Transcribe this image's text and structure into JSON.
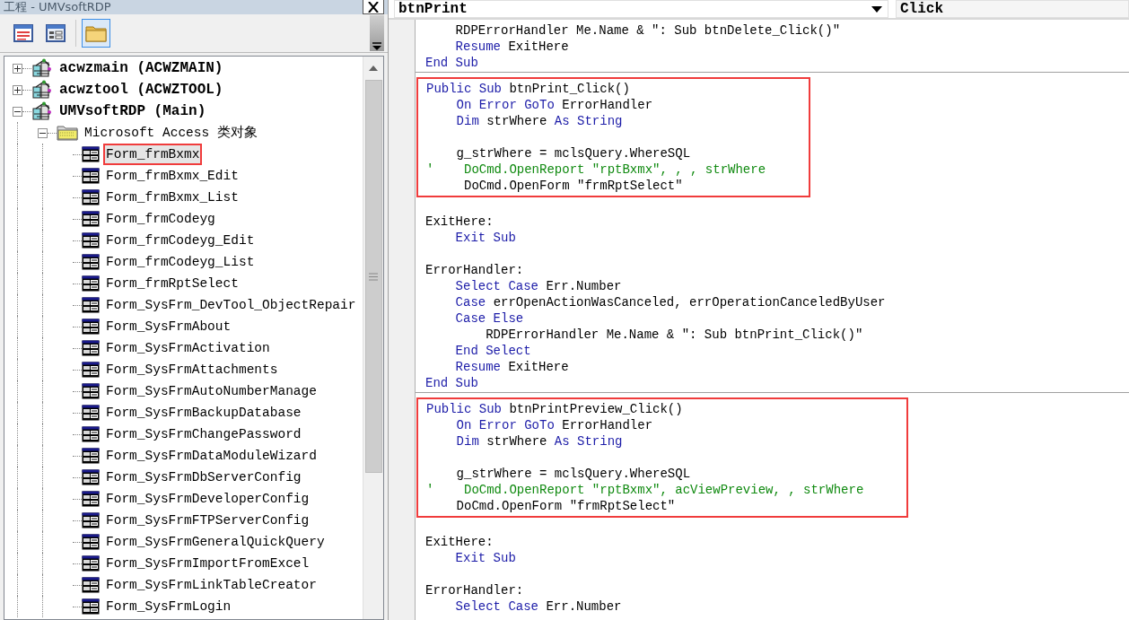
{
  "project_window": {
    "title": "工程 - UMVsoftRDP",
    "toolbar": [
      {
        "kind": "view-code",
        "selected": false
      },
      {
        "kind": "view-object",
        "selected": false
      },
      {
        "kind": "toggle-folders",
        "selected": true
      }
    ],
    "tree": [
      {
        "kind": "project",
        "label": "acwzmain (ACWZMAIN)",
        "expanded": false,
        "selected": false
      },
      {
        "kind": "project",
        "label": "acwztool (ACWZTOOL)",
        "expanded": false,
        "selected": false
      },
      {
        "kind": "project",
        "label": "UMVsoftRDP (Main)",
        "expanded": true,
        "selected": false,
        "children": [
          {
            "kind": "folder",
            "label": "Microsoft Access 类对象",
            "expanded": true,
            "selected": false,
            "children": [
              {
                "kind": "form",
                "label": "Form_frmBxmx",
                "selected": true,
                "highlighted": true
              },
              {
                "kind": "form",
                "label": "Form_frmBxmx_Edit",
                "selected": false,
                "highlighted": false
              },
              {
                "kind": "form",
                "label": "Form_frmBxmx_List",
                "selected": false,
                "highlighted": false
              },
              {
                "kind": "form",
                "label": "Form_frmCodeyg",
                "selected": false,
                "highlighted": false
              },
              {
                "kind": "form",
                "label": "Form_frmCodeyg_Edit",
                "selected": false,
                "highlighted": false
              },
              {
                "kind": "form",
                "label": "Form_frmCodeyg_List",
                "selected": false,
                "highlighted": false
              },
              {
                "kind": "form",
                "label": "Form_frmRptSelect",
                "selected": false,
                "highlighted": false
              },
              {
                "kind": "form",
                "label": "Form_SysFrm_DevTool_ObjectRepair",
                "selected": false,
                "highlighted": false
              },
              {
                "kind": "form",
                "label": "Form_SysFrmAbout",
                "selected": false,
                "highlighted": false
              },
              {
                "kind": "form",
                "label": "Form_SysFrmActivation",
                "selected": false,
                "highlighted": false
              },
              {
                "kind": "form",
                "label": "Form_SysFrmAttachments",
                "selected": false,
                "highlighted": false
              },
              {
                "kind": "form",
                "label": "Form_SysFrmAutoNumberManage",
                "selected": false,
                "highlighted": false
              },
              {
                "kind": "form",
                "label": "Form_SysFrmBackupDatabase",
                "selected": false,
                "highlighted": false
              },
              {
                "kind": "form",
                "label": "Form_SysFrmChangePassword",
                "selected": false,
                "highlighted": false
              },
              {
                "kind": "form",
                "label": "Form_SysFrmDataModuleWizard",
                "selected": false,
                "highlighted": false
              },
              {
                "kind": "form",
                "label": "Form_SysFrmDbServerConfig",
                "selected": false,
                "highlighted": false
              },
              {
                "kind": "form",
                "label": "Form_SysFrmDeveloperConfig",
                "selected": false,
                "highlighted": false
              },
              {
                "kind": "form",
                "label": "Form_SysFrmFTPServerConfig",
                "selected": false,
                "highlighted": false
              },
              {
                "kind": "form",
                "label": "Form_SysFrmGeneralQuickQuery",
                "selected": false,
                "highlighted": false
              },
              {
                "kind": "form",
                "label": "Form_SysFrmImportFromExcel",
                "selected": false,
                "highlighted": false
              },
              {
                "kind": "form",
                "label": "Form_SysFrmLinkTableCreator",
                "selected": false,
                "highlighted": false
              },
              {
                "kind": "form",
                "label": "Form_SysFrmLogin",
                "selected": false,
                "highlighted": false
              }
            ]
          }
        ]
      }
    ]
  },
  "code_window": {
    "object_list": "btnPrint",
    "procedure_list": "Click",
    "procedures": [
      {
        "groups": [
          {
            "highlighted": false,
            "lines": [
              {
                "kind": "code",
                "segments": [
                  {
                    "kind": "plain",
                    "text": "    RDPErrorHandler Me.Name & \": Sub btnDelete_Click()\""
                  }
                ]
              },
              {
                "kind": "code",
                "segments": [
                  {
                    "kind": "keyword",
                    "text": "    Resume "
                  },
                  {
                    "kind": "plain",
                    "text": "ExitHere"
                  }
                ]
              },
              {
                "kind": "code",
                "segments": [
                  {
                    "kind": "keyword",
                    "text": "End Sub"
                  }
                ]
              }
            ]
          }
        ]
      },
      {
        "groups": [
          {
            "highlighted": true,
            "lines": [
              {
                "kind": "code",
                "segments": [
                  {
                    "kind": "keyword",
                    "text": "Public Sub "
                  },
                  {
                    "kind": "plain",
                    "text": "btnPrint_Click()"
                  }
                ]
              },
              {
                "kind": "code",
                "segments": [
                  {
                    "kind": "keyword",
                    "text": "    On Error GoTo "
                  },
                  {
                    "kind": "plain",
                    "text": "ErrorHandler"
                  }
                ]
              },
              {
                "kind": "code",
                "segments": [
                  {
                    "kind": "keyword",
                    "text": "    Dim "
                  },
                  {
                    "kind": "plain",
                    "text": "strWhere "
                  },
                  {
                    "kind": "keyword",
                    "text": "As String"
                  }
                ]
              },
              {
                "kind": "blank"
              },
              {
                "kind": "code",
                "segments": [
                  {
                    "kind": "plain",
                    "text": "    g_strWhere = mclsQuery.WhereSQL"
                  }
                ]
              },
              {
                "kind": "code",
                "segments": [
                  {
                    "kind": "comment",
                    "text": "'    DoCmd.OpenReport \"rptBxmx\", , , strWhere"
                  }
                ]
              },
              {
                "kind": "code",
                "segments": [
                  {
                    "kind": "plain",
                    "text": "     DoCmd.OpenForm \"frmRptSelect\""
                  }
                ]
              }
            ]
          },
          {
            "highlighted": false,
            "lines": [
              {
                "kind": "blank"
              },
              {
                "kind": "code",
                "segments": [
                  {
                    "kind": "plain",
                    "text": "ExitHere:"
                  }
                ]
              },
              {
                "kind": "code",
                "segments": [
                  {
                    "kind": "keyword",
                    "text": "    Exit Sub"
                  }
                ]
              },
              {
                "kind": "blank"
              },
              {
                "kind": "code",
                "segments": [
                  {
                    "kind": "plain",
                    "text": "ErrorHandler:"
                  }
                ]
              },
              {
                "kind": "code",
                "segments": [
                  {
                    "kind": "keyword",
                    "text": "    Select Case "
                  },
                  {
                    "kind": "plain",
                    "text": "Err.Number"
                  }
                ]
              },
              {
                "kind": "code",
                "segments": [
                  {
                    "kind": "keyword",
                    "text": "    Case "
                  },
                  {
                    "kind": "plain",
                    "text": "errOpenActionWasCanceled, errOperationCanceledByUser"
                  }
                ]
              },
              {
                "kind": "code",
                "segments": [
                  {
                    "kind": "keyword",
                    "text": "    Case Else"
                  }
                ]
              },
              {
                "kind": "code",
                "segments": [
                  {
                    "kind": "plain",
                    "text": "        RDPErrorHandler Me.Name & \": Sub btnPrint_Click()\""
                  }
                ]
              },
              {
                "kind": "code",
                "segments": [
                  {
                    "kind": "keyword",
                    "text": "    End Select"
                  }
                ]
              },
              {
                "kind": "code",
                "segments": [
                  {
                    "kind": "keyword",
                    "text": "    Resume "
                  },
                  {
                    "kind": "plain",
                    "text": "ExitHere"
                  }
                ]
              },
              {
                "kind": "code",
                "segments": [
                  {
                    "kind": "keyword",
                    "text": "End Sub"
                  }
                ]
              }
            ]
          }
        ]
      },
      {
        "groups": [
          {
            "highlighted": true,
            "lines": [
              {
                "kind": "code",
                "segments": [
                  {
                    "kind": "keyword",
                    "text": "Public Sub "
                  },
                  {
                    "kind": "plain",
                    "text": "btnPrintPreview_Click()"
                  }
                ]
              },
              {
                "kind": "code",
                "segments": [
                  {
                    "kind": "keyword",
                    "text": "    On Error GoTo "
                  },
                  {
                    "kind": "plain",
                    "text": "ErrorHandler"
                  }
                ]
              },
              {
                "kind": "code",
                "segments": [
                  {
                    "kind": "keyword",
                    "text": "    Dim "
                  },
                  {
                    "kind": "plain",
                    "text": "strWhere "
                  },
                  {
                    "kind": "keyword",
                    "text": "As String"
                  }
                ]
              },
              {
                "kind": "blank"
              },
              {
                "kind": "code",
                "segments": [
                  {
                    "kind": "plain",
                    "text": "    g_strWhere = mclsQuery.WhereSQL"
                  }
                ]
              },
              {
                "kind": "code",
                "segments": [
                  {
                    "kind": "comment",
                    "text": "'    DoCmd.OpenReport \"rptBxmx\", acViewPreview, , strWhere"
                  }
                ]
              },
              {
                "kind": "code",
                "segments": [
                  {
                    "kind": "plain",
                    "text": "    DoCmd.OpenForm \"frmRptSelect\""
                  }
                ]
              }
            ]
          },
          {
            "highlighted": false,
            "lines": [
              {
                "kind": "blank"
              },
              {
                "kind": "code",
                "segments": [
                  {
                    "kind": "plain",
                    "text": "ExitHere:"
                  }
                ]
              },
              {
                "kind": "code",
                "segments": [
                  {
                    "kind": "keyword",
                    "text": "    Exit Sub"
                  }
                ]
              },
              {
                "kind": "blank"
              },
              {
                "kind": "code",
                "segments": [
                  {
                    "kind": "plain",
                    "text": "ErrorHandler:"
                  }
                ]
              },
              {
                "kind": "code",
                "segments": [
                  {
                    "kind": "keyword",
                    "text": "    Select Case "
                  },
                  {
                    "kind": "plain",
                    "text": "Err.Number"
                  }
                ]
              }
            ]
          }
        ]
      }
    ]
  }
}
